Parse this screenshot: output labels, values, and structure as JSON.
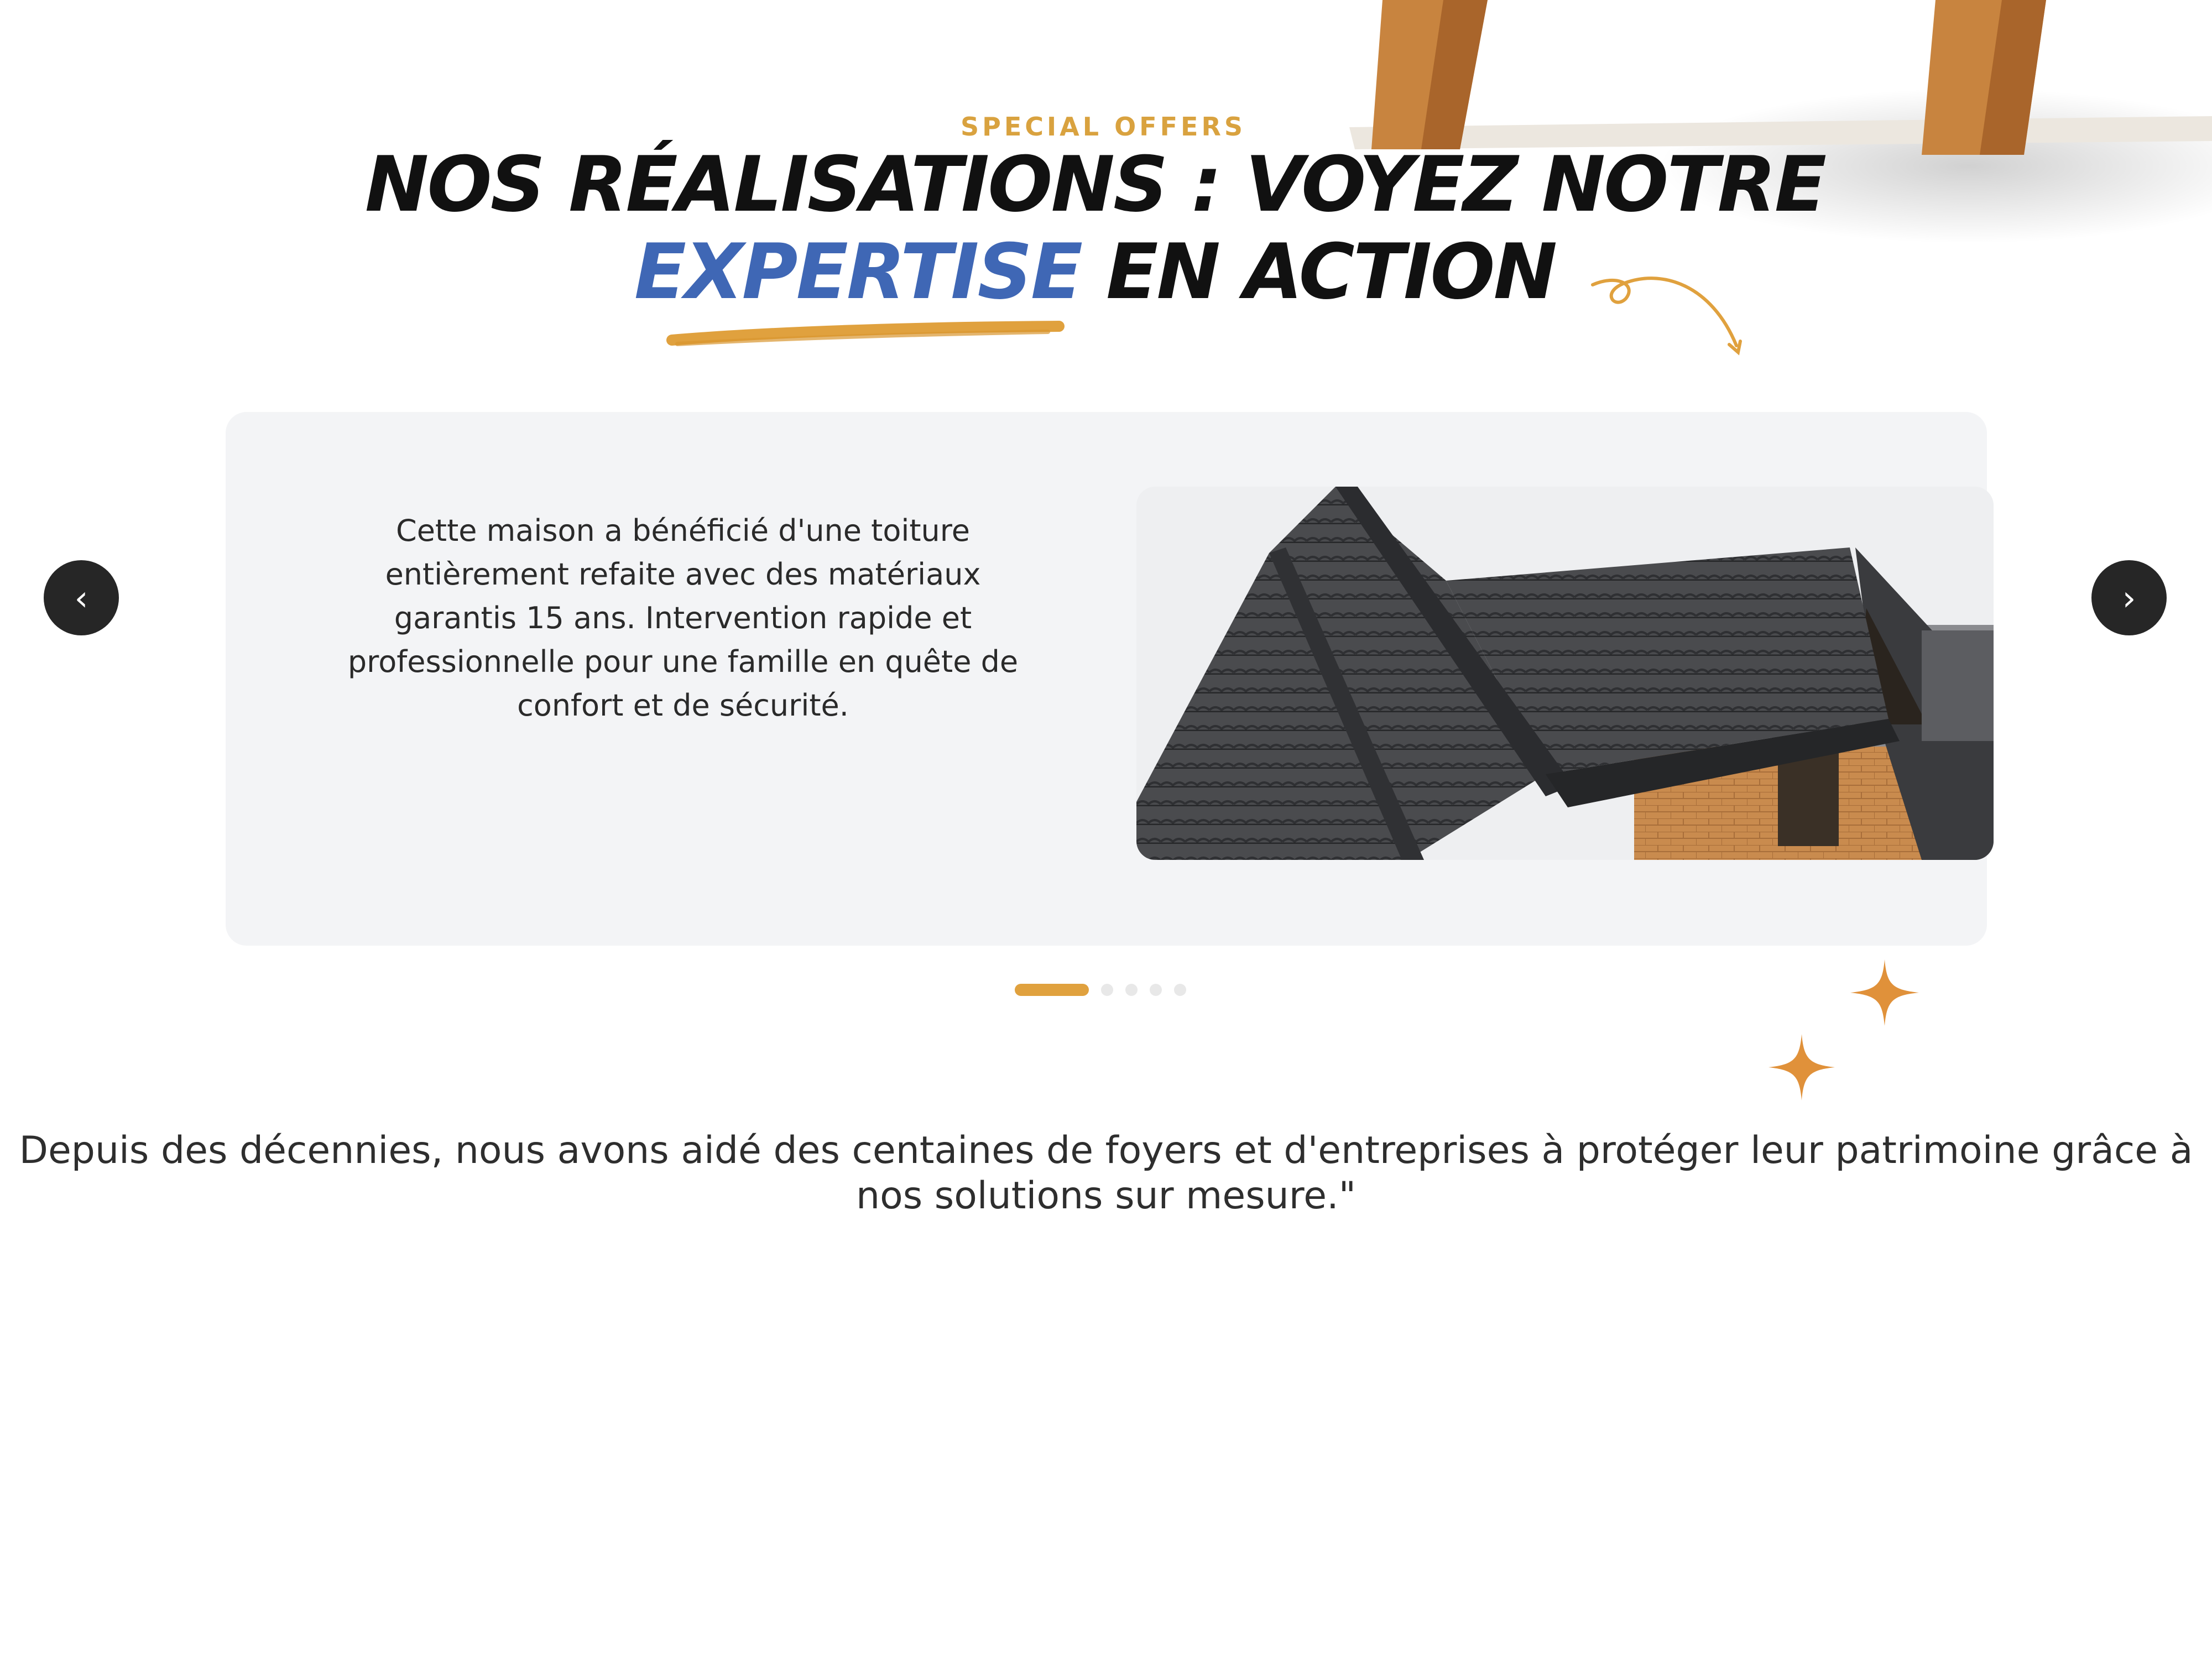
{
  "section": {
    "eyebrow": "SPECIAL OFFERS",
    "title_part1": "NOS RÉALISATIONS : VOYEZ NOTRE",
    "title_accent": "EXPERTISE",
    "title_part2": " EN ACTION"
  },
  "carousel": {
    "slide_text": "Cette maison a bénéficié d'une toiture entièrement refaite avec des matériaux garantis 15 ans. Intervention rapide et professionnelle pour une famille en quête de confort et de sécurité.",
    "prev_icon": "chevron-left-icon",
    "next_icon": "chevron-right-icon",
    "prev_glyph": "‹",
    "next_glyph": "›",
    "slide_count": 5,
    "active_index": 0
  },
  "footer": {
    "text": "Depuis des décennies, nous avons aidé des centaines de foyers et d'entreprises à protéger leur patrimoine grâce à nos solutions sur mesure.\""
  },
  "colors": {
    "accent_orange": "#e0a13e",
    "accent_blue": "#3f67b5",
    "card_bg": "#f3f4f6",
    "nav_bg": "#262626"
  }
}
